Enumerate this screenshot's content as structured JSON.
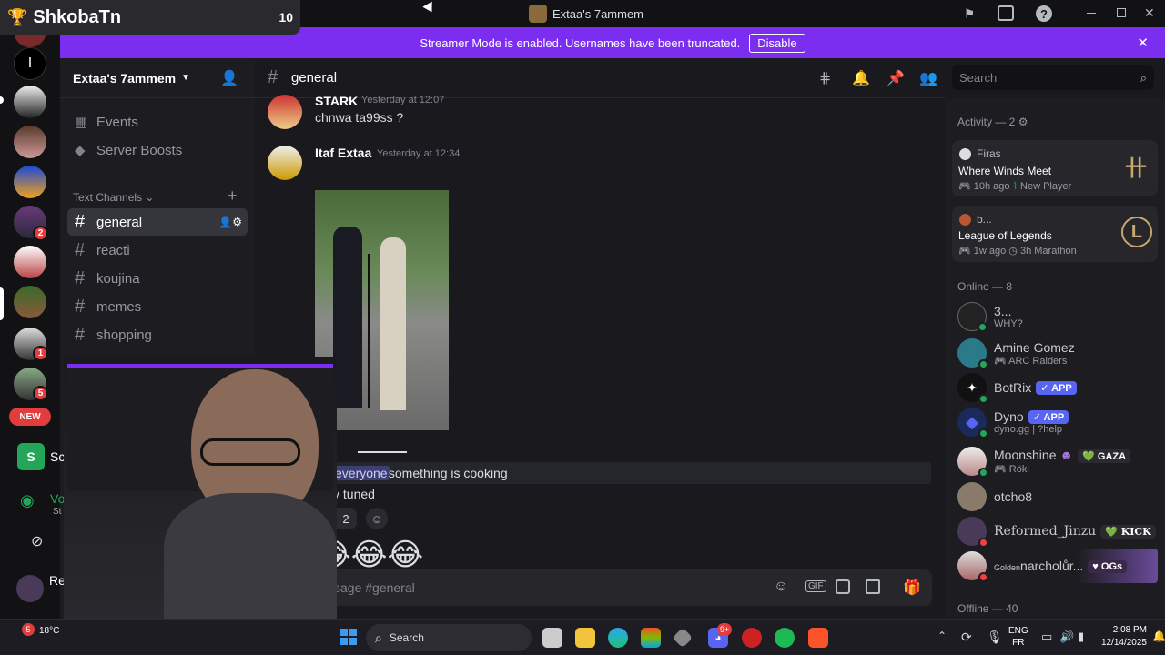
{
  "overlay": {
    "name": "ShkobaTn",
    "count": "10"
  },
  "window": {
    "title": "Extaa's 7ammem"
  },
  "banner": {
    "text": "Streamer Mode is enabled. Usernames have been truncated.",
    "button": "Disable"
  },
  "server": {
    "name": "Extaa's 7ammem"
  },
  "servers": {
    "new_badge": "NEW",
    "badges": [
      "2",
      "1",
      "5"
    ]
  },
  "nav": {
    "events": "Events",
    "boosts": "Server Boosts",
    "category": "Text Channels"
  },
  "channels": [
    "general",
    "reacti",
    "koujina",
    "memes",
    "shopping"
  ],
  "header": {
    "channel": "general",
    "search_placeholder": "Search"
  },
  "messages": [
    {
      "author": "STARK",
      "time": "Yesterday at 12:07",
      "text": "chnwa ta99ss ?"
    },
    {
      "author": "Itaf Extaa",
      "time": "Yesterday at 12:34"
    }
  ],
  "message_text": {
    "mention": "everyone",
    "body": " something is cooking",
    "line2": "y tuned"
  },
  "reaction": {
    "count": "2"
  },
  "composer": {
    "placeholder": "ssage #general"
  },
  "activity": {
    "heading": "Activity — 2",
    "items": [
      {
        "user": "Firas",
        "game": "Where Winds Meet",
        "ago": "10h ago",
        "detail": "New Player"
      },
      {
        "user": "b...",
        "game": "League of Legends",
        "ago": "1w ago",
        "detail": "3h Marathon"
      }
    ]
  },
  "online": {
    "heading": "Online — 8",
    "members": [
      {
        "name": "3...",
        "sub": "WHY?"
      },
      {
        "name": "Amine Gomez",
        "sub": "ARC Raiders"
      },
      {
        "name": "BotRix",
        "tag": "✓ APP"
      },
      {
        "name": "Dyno",
        "tag": "✓ APP",
        "sub": "dyno.gg | ?help"
      },
      {
        "name": "Moonshine",
        "tag": "GAZA",
        "sub": "Röki"
      },
      {
        "name": "otcho8"
      },
      {
        "name": "Reformed_Jinzu",
        "tag": "KICK"
      },
      {
        "name": "narcholůr...",
        "prefix": "Golden",
        "tag": "OGs"
      }
    ]
  },
  "offline": {
    "heading": "Offline — 40"
  },
  "sidebar_cut": {
    "sc": "Sc",
    "vo": "Vo",
    "st": "St",
    "ref": "Ref"
  },
  "taskbar": {
    "weather": "18°C",
    "search": "Search",
    "lang1": "ENG",
    "lang2": "FR",
    "time": "2:08 PM",
    "date": "12/14/2025",
    "discord_badge": "9+",
    "weather_badge": "5"
  },
  "colors": {
    "accent": "#7b2df0",
    "blurple": "#5865f2",
    "online": "#23a55a",
    "dnd": "#f23f43",
    "mention": "#3c3f70"
  }
}
